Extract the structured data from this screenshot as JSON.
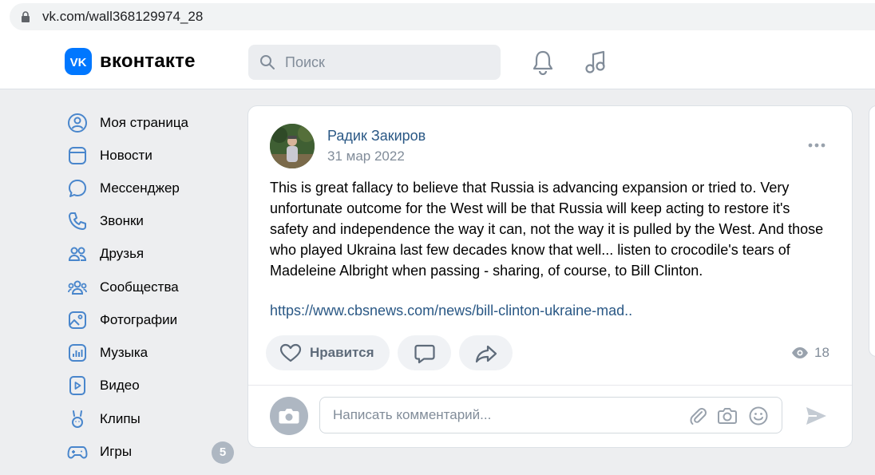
{
  "browser": {
    "url": "vk.com/wall368129974_28"
  },
  "header": {
    "logo_text": "вконтакте",
    "search_placeholder": "Поиск",
    "accent_color": "#0077ff"
  },
  "nav": {
    "items": [
      {
        "label": "Моя страница",
        "icon": "profile-icon"
      },
      {
        "label": "Новости",
        "icon": "news-icon"
      },
      {
        "label": "Мессенджер",
        "icon": "messenger-icon"
      },
      {
        "label": "Звонки",
        "icon": "phone-icon"
      },
      {
        "label": "Друзья",
        "icon": "friends-icon"
      },
      {
        "label": "Сообщества",
        "icon": "communities-icon"
      },
      {
        "label": "Фотографии",
        "icon": "photos-icon"
      },
      {
        "label": "Музыка",
        "icon": "music-icon"
      },
      {
        "label": "Видео",
        "icon": "video-icon"
      },
      {
        "label": "Клипы",
        "icon": "clips-icon"
      },
      {
        "label": "Игры",
        "icon": "games-icon",
        "badge": "5"
      }
    ]
  },
  "post": {
    "author": "Радик Закиров",
    "date": "31 мар 2022",
    "text": "This is great fallacy to believe that Russia is advancing expansion or tried to. Very unfortunate outcome for the West will be that Russia will keep acting to restore it's safety and independence the way it can, not the way it is pulled by the West. And those who played Ukraina last few decades know that well... listen to crocodile's tears of Madeleine Albright when passing - sharing, of course, to Bill Clinton.",
    "link": "https://www.cbsnews.com/news/bill-clinton-ukraine-mad..",
    "like_label": "Нравится",
    "views": "18"
  },
  "comment": {
    "placeholder": "Написать комментарий..."
  }
}
